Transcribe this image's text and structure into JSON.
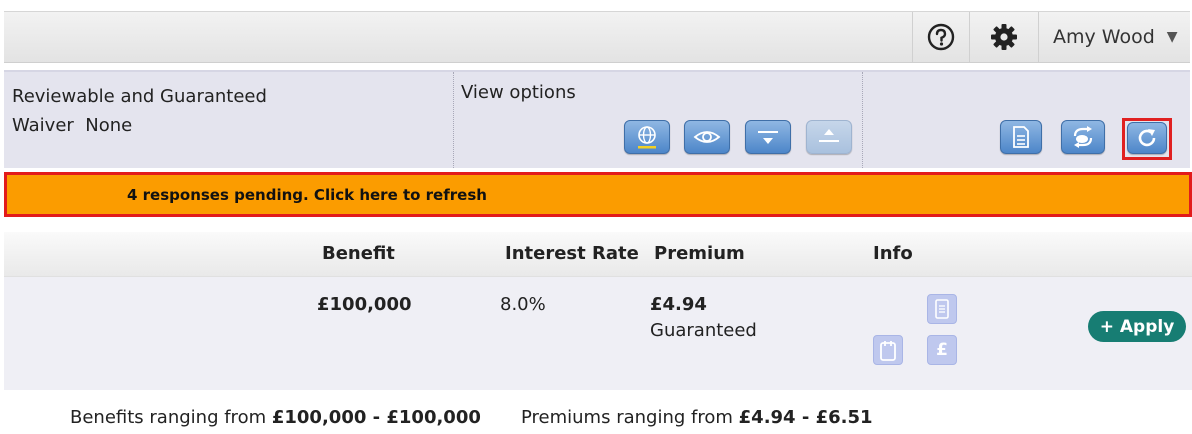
{
  "header": {
    "user_name": "Amy Wood",
    "icons": [
      "help-icon",
      "gear-icon",
      "chevron-down-icon"
    ]
  },
  "options": {
    "line1": "Reviewable and Guaranteed",
    "line2": "Waiver  None",
    "view_options_label": "View options",
    "view_buttons": [
      "globe-icon",
      "eye-icon",
      "expand-down-icon",
      "collapse-up-icon"
    ],
    "action_buttons": [
      "document-icon",
      "swap-icon",
      "refresh-icon"
    ]
  },
  "banner": {
    "text": "4 responses pending. Click here to refresh",
    "color": "#fb9c00"
  },
  "table": {
    "headers": {
      "benefit": "Benefit",
      "interest_rate": "Interest Rate",
      "premium": "Premium",
      "info": "Info"
    },
    "rows": [
      {
        "benefit": "£100,000",
        "interest_rate": "8.0%",
        "premium": "£4.94",
        "premium_note": "Guaranteed",
        "apply_label": "+ Apply"
      }
    ]
  },
  "summary": {
    "benefits_prefix": "Benefits ranging from",
    "benefits_range": "£100,000 - £100,000",
    "premiums_prefix": "Premiums ranging from",
    "premiums_range": "£4.94 - £6.51"
  },
  "colors": {
    "apply": "#177d73",
    "banner_border": "#e21b1b",
    "accent_blue": "#4d86c9"
  }
}
